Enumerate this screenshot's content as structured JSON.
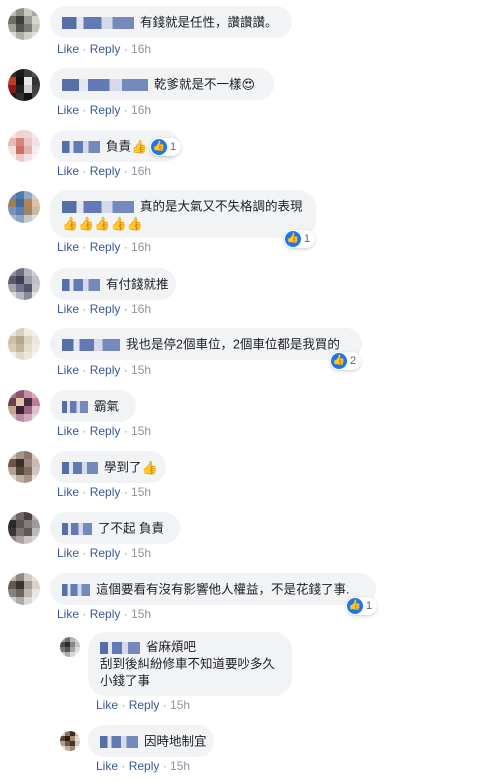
{
  "actions": {
    "like": "Like",
    "reply": "Reply",
    "sep": " · "
  },
  "comments": [
    {
      "text": "有錢就是任性，讚讚讚。",
      "time": "16h"
    },
    {
      "text": "乾爹就是不一樣",
      "emoji": "😍",
      "time": "16h"
    },
    {
      "text": "負責",
      "emoji": "👍",
      "reaction_count": "1",
      "time": "16h"
    },
    {
      "text": "真的是大氣又不失格調的表現",
      "line2": "👍👍👍👍👍",
      "reaction_count": "1",
      "time": "16h"
    },
    {
      "text": "有付錢就推",
      "time": "16h"
    },
    {
      "text": "我也是停2個車位，2個車位都是我買的",
      "reaction_count": "2",
      "time": "15h"
    },
    {
      "text": "霸氣",
      "time": "15h"
    },
    {
      "text": "學到了",
      "emoji": "👍",
      "time": "15h"
    },
    {
      "text": "了不起 負責",
      "time": "15h"
    },
    {
      "text": "這個要看有沒有影響他人權益，不是花錢了事.",
      "reaction_count": "1",
      "time": "15h"
    }
  ],
  "replies": [
    {
      "text": "省麻煩吧",
      "line2": "刮到後糾紛修車不知道要吵多久",
      "line3": "小錢了事",
      "time": "15h"
    },
    {
      "text": "因時地制宜",
      "time": "15h"
    }
  ]
}
